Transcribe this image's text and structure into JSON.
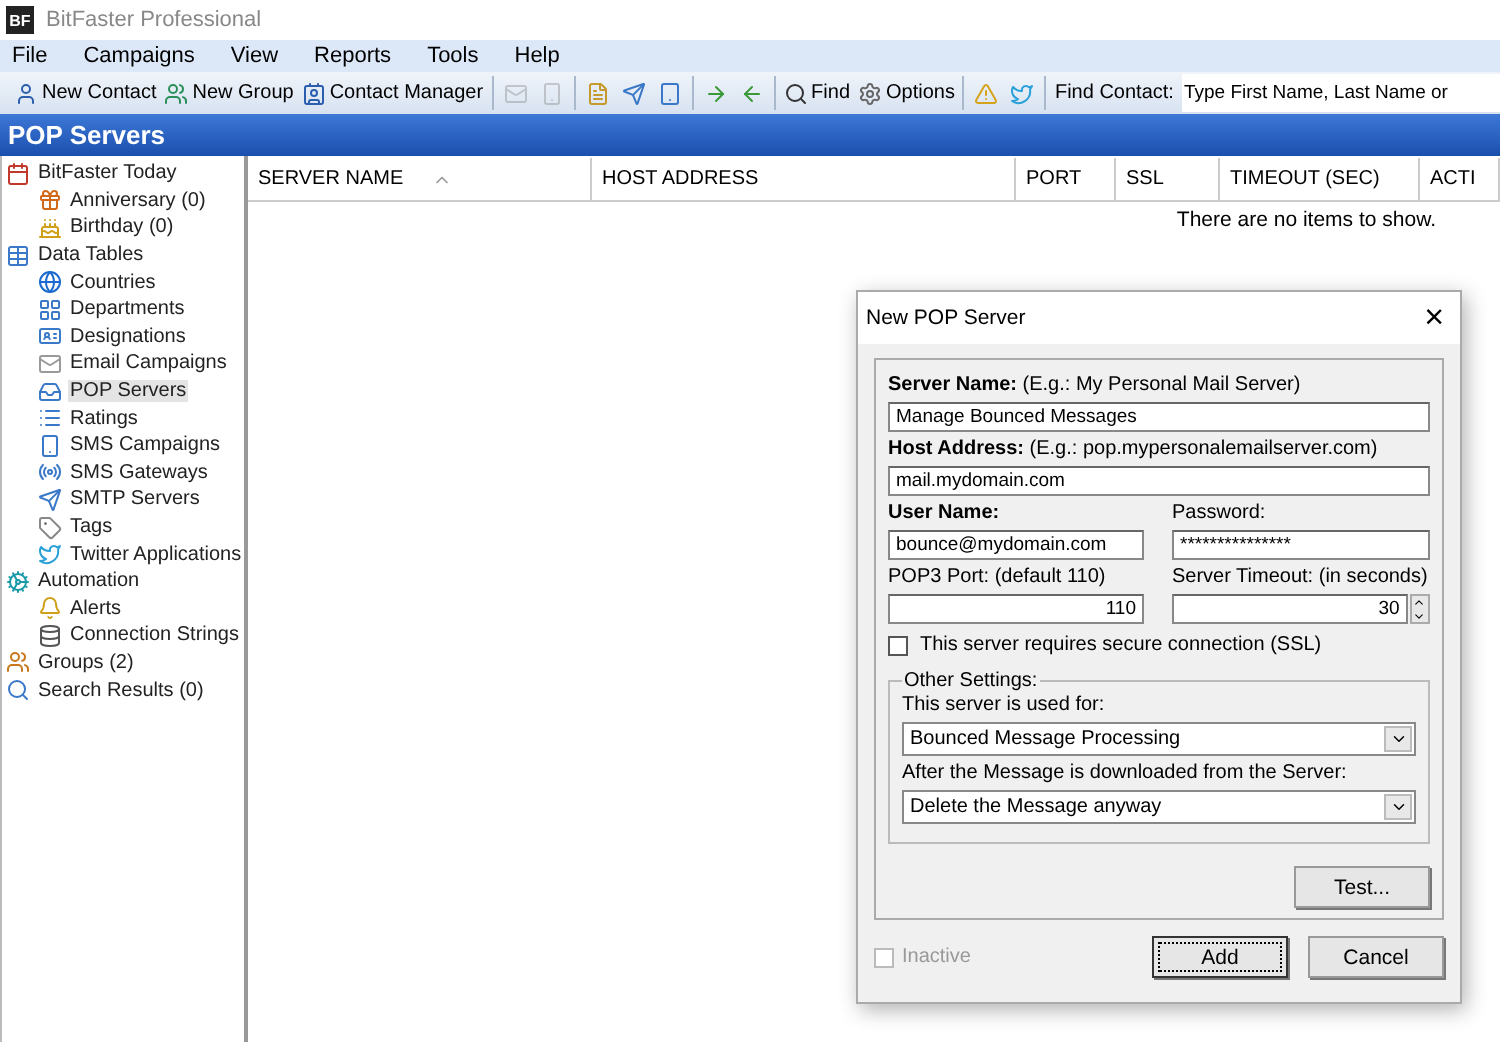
{
  "window": {
    "title": "BitFaster Professional",
    "logo": "BF"
  },
  "menu": [
    "File",
    "Campaigns",
    "View",
    "Reports",
    "Tools",
    "Help"
  ],
  "toolbar": {
    "groups": [
      [
        {
          "kind": "button",
          "label": "New Contact"
        },
        {
          "kind": "button",
          "label": "New Group"
        },
        {
          "kind": "button",
          "label": "Contact Manager"
        }
      ],
      [
        {
          "kind": "icon",
          "disabled": true
        },
        {
          "kind": "icon",
          "disabled": true
        }
      ],
      [
        {
          "kind": "icon",
          "disabled": false
        },
        {
          "kind": "icon",
          "disabled": false
        },
        {
          "kind": "icon",
          "disabled": false
        }
      ],
      [
        {
          "kind": "icon",
          "disabled": false
        },
        {
          "kind": "icon",
          "disabled": false
        }
      ],
      [
        {
          "kind": "button",
          "label": "Find"
        },
        {
          "kind": "button",
          "label": "Options"
        }
      ],
      [
        {
          "kind": "icon",
          "disabled": false
        },
        {
          "kind": "icon",
          "disabled": false
        }
      ]
    ],
    "find_label": "Find Contact:",
    "find_placeholder": "Type First Name, Last Name or"
  },
  "page_title": "POP Servers",
  "sidebar": {
    "items": [
      {
        "label": "BitFaster Today",
        "selected": false,
        "children": [
          {
            "label": "Anniversary (0)",
            "selected": false
          },
          {
            "label": "Birthday (0)",
            "selected": false
          }
        ]
      },
      {
        "label": "Data Tables",
        "selected": false,
        "children": [
          {
            "label": "Countries",
            "selected": false
          },
          {
            "label": "Departments",
            "selected": false
          },
          {
            "label": "Designations",
            "selected": false
          },
          {
            "label": "Email Campaigns",
            "selected": false
          },
          {
            "label": "POP Servers",
            "selected": true
          },
          {
            "label": "Ratings",
            "selected": false
          },
          {
            "label": "SMS Campaigns",
            "selected": false
          },
          {
            "label": "SMS Gateways",
            "selected": false
          },
          {
            "label": "SMTP Servers",
            "selected": false
          },
          {
            "label": "Tags",
            "selected": false
          },
          {
            "label": "Twitter Applications",
            "selected": false
          }
        ]
      },
      {
        "label": "Automation",
        "selected": false,
        "children": [
          {
            "label": "Alerts",
            "selected": false
          },
          {
            "label": "Connection Strings",
            "selected": false
          }
        ]
      },
      {
        "label": "Groups (2)",
        "selected": false
      },
      {
        "label": "Search Results (0)",
        "selected": false
      }
    ]
  },
  "table": {
    "columns": [
      {
        "label": "SERVER NAME",
        "sorted": true
      },
      {
        "label": "HOST ADDRESS"
      },
      {
        "label": "PORT"
      },
      {
        "label": "SSL"
      },
      {
        "label": "TIMEOUT (SEC)"
      },
      {
        "label": "ACTI"
      }
    ],
    "empty_message": "There are no items to show."
  },
  "dialog": {
    "title": "New POP Server",
    "close": "×",
    "server_name": {
      "label": "Server Name:",
      "hint": "(E.g.: My Personal Mail Server)",
      "value": "Manage Bounced Messages"
    },
    "host_address": {
      "label": "Host Address:",
      "hint": "(E.g.: pop.mypersonalemailserver.com)",
      "value": "mail.mydomain.com"
    },
    "user_name": {
      "label": "User Name:",
      "value": "bounce@mydomain.com"
    },
    "password": {
      "label": "Password:",
      "value": "***************"
    },
    "port": {
      "label": "POP3 Port: (default 110)",
      "value": "110"
    },
    "timeout": {
      "label": "Server Timeout: (in seconds)",
      "value": "30"
    },
    "ssl": {
      "label": "This server requires secure connection (SSL)",
      "checked": false
    },
    "other_settings": {
      "legend": "Other Settings:",
      "used_for": {
        "label": "This server is used for:",
        "value": "Bounced Message Processing"
      },
      "after_download": {
        "label": "After the Message is downloaded from the Server:",
        "value": "Delete the Message anyway"
      }
    },
    "test_button": "Test...",
    "inactive": {
      "label": "Inactive",
      "checked": false,
      "disabled": true
    },
    "buttons": [
      {
        "label": "Add",
        "focused": true
      },
      {
        "label": "Cancel",
        "focused": false
      }
    ]
  }
}
